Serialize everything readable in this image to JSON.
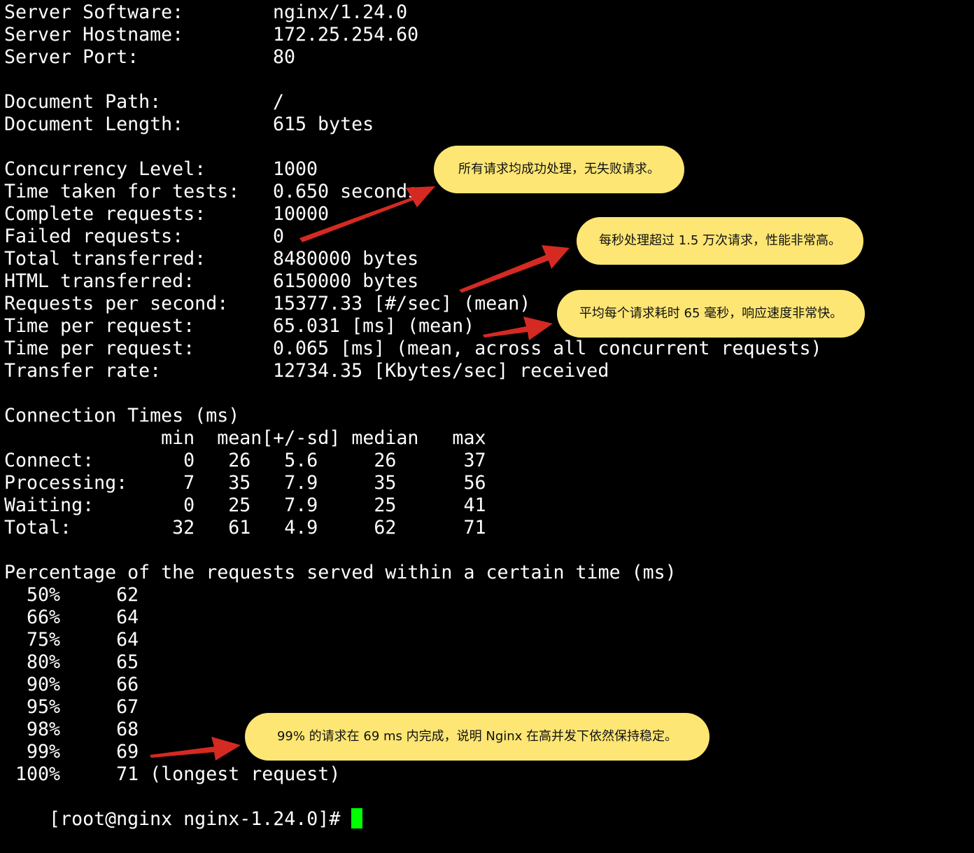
{
  "colors": {
    "background": "#000000",
    "text": "#ffffff",
    "cursor": "#00ff00",
    "callout": "#fde674",
    "arrow": "#d42a22"
  },
  "server": [
    {
      "label": "Server Software:",
      "value": "nginx/1.24.0"
    },
    {
      "label": "Server Hostname:",
      "value": "172.25.254.60"
    },
    {
      "label": "Server Port:",
      "value": "80"
    }
  ],
  "document": [
    {
      "label": "Document Path:",
      "value": "/"
    },
    {
      "label": "Document Length:",
      "value": "615 bytes"
    }
  ],
  "stats": [
    {
      "label": "Concurrency Level:",
      "value": "1000"
    },
    {
      "label": "Time taken for tests:",
      "value": "0.650 seconds"
    },
    {
      "label": "Complete requests:",
      "value": "10000"
    },
    {
      "label": "Failed requests:",
      "value": "0"
    },
    {
      "label": "Total transferred:",
      "value": "8480000 bytes"
    },
    {
      "label": "HTML transferred:",
      "value": "6150000 bytes"
    },
    {
      "label": "Requests per second:",
      "value": "15377.33 [#/sec] (mean)"
    },
    {
      "label": "Time per request:",
      "value": "65.031 [ms] (mean)"
    },
    {
      "label": "Time per request:",
      "value": "0.065 [ms] (mean, across all concurrent requests)"
    },
    {
      "label": "Transfer rate:",
      "value": "12734.35 [Kbytes/sec] received"
    }
  ],
  "connection_times": {
    "title": "Connection Times (ms)",
    "header": "              min  mean[+/-sd] median   max",
    "rows": [
      "Connect:        0   26   5.6     26      37",
      "Processing:     7   35   7.9     35      56",
      "Waiting:        0   25   7.9     25      41",
      "Total:         32   61   4.9     62      71"
    ]
  },
  "percentiles": {
    "title": "Percentage of the requests served within a certain time (ms)",
    "rows": [
      "  50%     62",
      "  66%     64",
      "  75%     64",
      "  80%     65",
      "  90%     66",
      "  95%     67",
      "  98%     68",
      "  99%     69",
      " 100%     71 (longest request)"
    ]
  },
  "prompt": "[root@nginx nginx-1.24.0]# ",
  "callouts": [
    "所有请求均成功处理，无失败请求。",
    "每秒处理超过 1.5 万次请求，性能非常高。",
    "平均每个请求耗时 65 毫秒，响应速度非常快。",
    "99% 的请求在 69 ms 内完成，说明 Nginx 在高并发下依然保持稳定。"
  ]
}
